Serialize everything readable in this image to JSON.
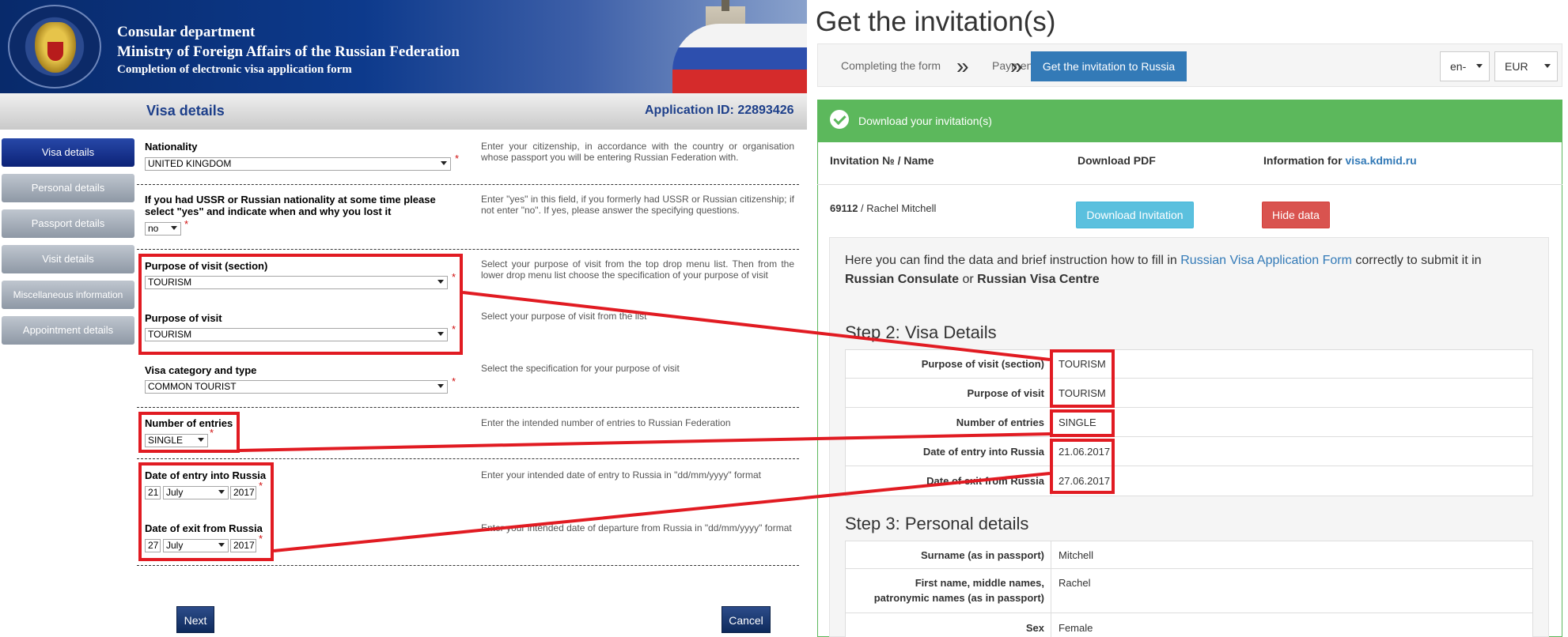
{
  "left": {
    "banner": {
      "line1": "Consular department",
      "line2": "Ministry of Foreign Affairs of the Russian Federation",
      "line3": "Completion of electronic visa application form"
    },
    "section_title": "Visa details",
    "application_id": "Application ID: 22893426",
    "nav": [
      "Visa details",
      "Personal details",
      "Passport details",
      "Visit details",
      "Miscellaneous information",
      "Appointment details"
    ],
    "fields": {
      "nationality": {
        "label": "Nationality",
        "value": "UNITED KINGDOM",
        "help": "Enter your citizenship, in accordance with the country or organisation whose passport you will be entering Russian Federation with."
      },
      "ussr": {
        "label": "If you had USSR or Russian nationality at some time please select \"yes\" and indicate when and why you lost it",
        "value": "no",
        "help": "Enter \"yes\" in this field, if you formerly had USSR or Russian citizenship; if not enter \"no\". If yes, please answer the specifying questions."
      },
      "purpose_section": {
        "label": "Purpose of visit (section)",
        "value": "TOURISM",
        "help": "Select your purpose of visit from the top drop menu list. Then from the lower drop menu list choose the specification of your purpose of visit"
      },
      "purpose": {
        "label": "Purpose of visit",
        "value": "TOURISM",
        "help": "Select your purpose of visit from the list"
      },
      "category": {
        "label": "Visa category and type",
        "value": "COMMON TOURIST",
        "help": "Select the specification for your purpose of visit"
      },
      "entries": {
        "label": "Number of entries",
        "value": "SINGLE",
        "help": "Enter the intended number of entries to Russian Federation"
      },
      "entry_date": {
        "label": "Date of entry into Russia",
        "day": "21",
        "month": "July",
        "year": "2017",
        "help": "Enter your intended date of entry to Russia in \"dd/mm/yyyy\" format"
      },
      "exit_date": {
        "label": "Date of exit from Russia",
        "day": "27",
        "month": "July",
        "year": "2017",
        "help": "Enter your intended date of departure from Russia in \"dd/mm/yyyy\" format"
      }
    },
    "required_mark": "*",
    "buttons": {
      "next": "Next",
      "cancel": "Cancel"
    }
  },
  "right": {
    "title": "Get the invitation(s)",
    "steps": [
      "Completing the form",
      "Payment",
      "Get the invitation to Russia"
    ],
    "chevron": "»",
    "lang": "en-",
    "currency": "EUR",
    "panel_heading": "Download your invitation(s)",
    "columns": {
      "inv": "Invitation № / Name",
      "pdf": "Download PDF",
      "info_prefix": "Information for ",
      "info_link": "visa.kdmid.ru"
    },
    "invitation": {
      "number": "69112",
      "name": " / Rachel Mitchell"
    },
    "buttons": {
      "download": "Download Invitation",
      "hide": "Hide data"
    },
    "intro": {
      "t1": "Here you can find the data and brief instruction how to fill in ",
      "link": "Russian Visa Application Form",
      "t2": " correctly to submit it in ",
      "b1": "Russian Consulate",
      "t3": " or ",
      "b2": "Russian Visa Centre"
    },
    "step2": {
      "heading": "Step 2: Visa Details",
      "rows": [
        {
          "key": "Purpose of visit (section)",
          "value": "TOURISM"
        },
        {
          "key": "Purpose of visit",
          "value": "TOURISM"
        },
        {
          "key": "Number of entries",
          "value": "SINGLE"
        },
        {
          "key": "Date of entry into Russia",
          "value": "21.06.2017"
        },
        {
          "key": "Date of exit from Russia",
          "value": "27.06.2017"
        }
      ]
    },
    "step3": {
      "heading": "Step 3: Personal details",
      "rows": [
        {
          "key": "Surname (as in passport)",
          "value": "Mitchell"
        },
        {
          "key": "First name, middle names,",
          "key2": "patronymic names (as in passport)",
          "value": "Rachel"
        },
        {
          "key": "Sex",
          "value": "Female"
        }
      ]
    }
  },
  "colors": {
    "annotation_red": "#e11b22",
    "nav_active": "#0c2277",
    "panel_green": "#5cb85c",
    "step_active": "#337ab7"
  }
}
